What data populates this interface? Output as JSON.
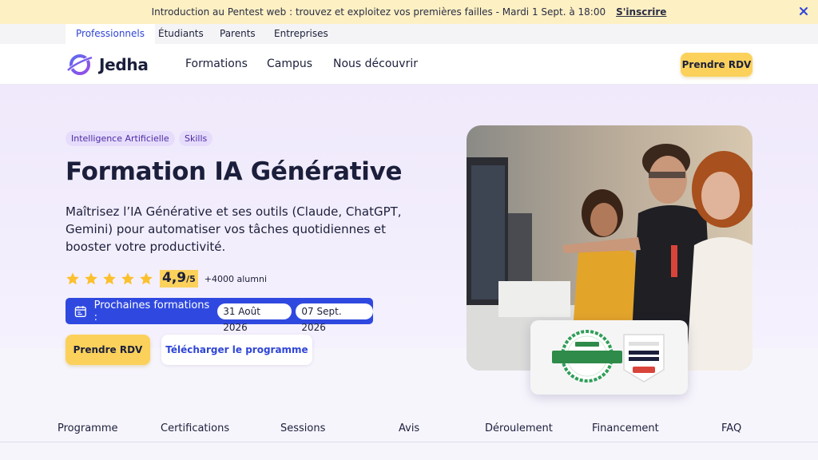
{
  "banner": {
    "text": "Introduction au Pentest web : trouvez et exploitez vos premières failles - Mardi 1 Sept. à 18:00",
    "link": "S'inscrire",
    "close_icon": "close-icon"
  },
  "audience_tabs": [
    "Professionnels",
    "Étudiants",
    "Parents",
    "Entreprises"
  ],
  "header": {
    "logo_text": "Jedha",
    "nav": [
      "Formations",
      "Campus",
      "Nous découvrir"
    ],
    "cta": "Prendre RDV"
  },
  "hero": {
    "tags": [
      "Intelligence Artificielle",
      "Skills"
    ],
    "title": "Formation IA Générative",
    "subtitle": "Maîtrisez l’IA Générative et ses outils (Claude, ChatGPT, Gemini) pour automatiser vos tâches quotidiennes et booster votre productivité.",
    "rating": {
      "stars": 5,
      "score": "4,9",
      "score_suffix": "/5",
      "alumni": "+4000 alumni"
    },
    "sessions": {
      "label": "Prochaines formations :",
      "dates": [
        "31 Août 2026",
        "07 Sept. 2026"
      ]
    },
    "cta_primary": "Prendre RDV",
    "cta_secondary": "Télécharger le programme"
  },
  "section_nav": [
    "Programme",
    "Certifications",
    "Sessions",
    "Avis",
    "Déroulement",
    "Financement",
    "FAQ"
  ],
  "colors": {
    "accent_blue": "#2f49e0",
    "accent_yellow": "#fbd15b",
    "tag_bg": "#e6dcfb",
    "hero_bg": "#efe9fb"
  }
}
